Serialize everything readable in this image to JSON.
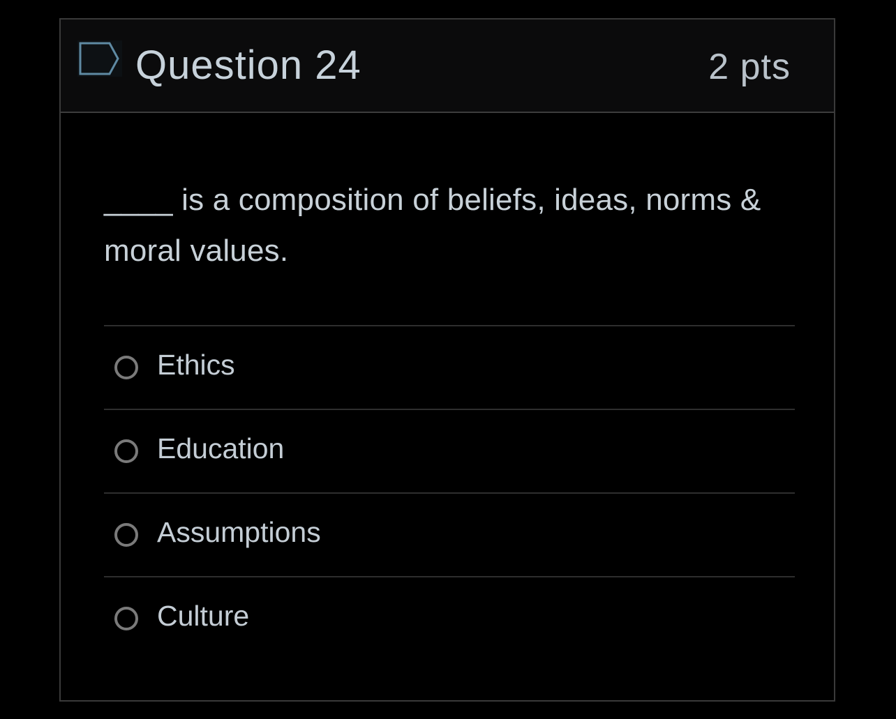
{
  "question": {
    "title": "Question 24",
    "points": "2 pts",
    "flag_icon": "flag-icon",
    "text": "____ is a composition of beliefs, ideas, norms & moral values."
  },
  "answers": [
    {
      "label": "Ethics",
      "selected": false
    },
    {
      "label": "Education",
      "selected": false
    },
    {
      "label": "Assumptions",
      "selected": false
    },
    {
      "label": "Culture",
      "selected": false
    }
  ],
  "colors": {
    "background": "#000000",
    "header_background": "#0b0b0c",
    "text": "#c7d2db",
    "flag_stroke": "#5f8aa3",
    "radio_border": "#7a7a7a",
    "divider": "#2e2e2e"
  }
}
